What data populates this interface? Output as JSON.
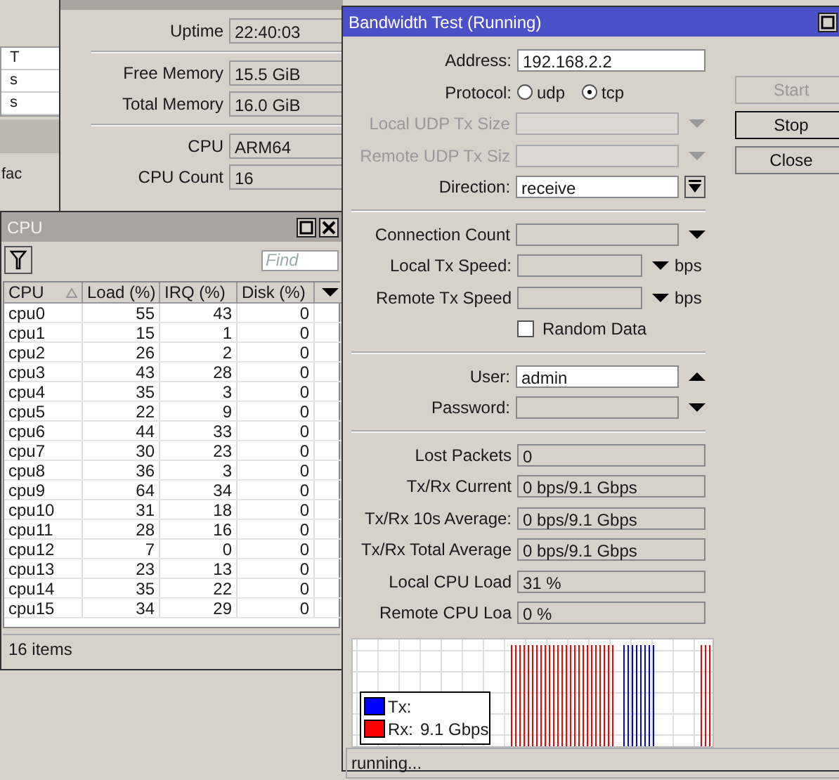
{
  "background_window": {
    "column_1": "T",
    "cells": [
      "s",
      "s"
    ],
    "label": "fac"
  },
  "resources": {
    "sections": [
      {
        "rows": [
          {
            "label": "Uptime",
            "value": "22:40:03"
          }
        ]
      },
      {
        "rows": [
          {
            "label": "Free Memory",
            "value": "15.5 GiB"
          },
          {
            "label": "Total Memory",
            "value": "16.0 GiB"
          }
        ]
      },
      {
        "rows": [
          {
            "label": "CPU",
            "value": "ARM64"
          },
          {
            "label": "CPU Count",
            "value": "16"
          }
        ]
      }
    ]
  },
  "cpu_window": {
    "title": "CPU",
    "search": {
      "placeholder": "Find"
    },
    "table": {
      "columns": [
        {
          "label": "CPU",
          "sorted": true
        },
        {
          "label": "Load (%)",
          "sorted": false
        },
        {
          "label": "IRQ (%)",
          "sorted": false
        },
        {
          "label": "Disk (%)",
          "sorted": false
        }
      ],
      "rows": [
        [
          "cpu0",
          "55",
          "43",
          "0"
        ],
        [
          "cpu1",
          "15",
          "1",
          "0"
        ],
        [
          "cpu2",
          "26",
          "2",
          "0"
        ],
        [
          "cpu3",
          "43",
          "28",
          "0"
        ],
        [
          "cpu4",
          "35",
          "3",
          "0"
        ],
        [
          "cpu5",
          "22",
          "9",
          "0"
        ],
        [
          "cpu6",
          "44",
          "33",
          "0"
        ],
        [
          "cpu7",
          "30",
          "23",
          "0"
        ],
        [
          "cpu8",
          "36",
          "3",
          "0"
        ],
        [
          "cpu9",
          "64",
          "34",
          "0"
        ],
        [
          "cpu10",
          "31",
          "18",
          "0"
        ],
        [
          "cpu11",
          "28",
          "16",
          "0"
        ],
        [
          "cpu12",
          "7",
          "0",
          "0"
        ],
        [
          "cpu13",
          "23",
          "13",
          "0"
        ],
        [
          "cpu14",
          "35",
          "22",
          "0"
        ],
        [
          "cpu15",
          "34",
          "29",
          "0"
        ]
      ]
    },
    "status_bar": "16 items"
  },
  "bandwidth_window": {
    "title": "Bandwidth Test (Running)",
    "active": true,
    "buttons": [
      {
        "label": "Start",
        "disabled": true,
        "default": false
      },
      {
        "label": "Stop",
        "disabled": false,
        "default": true
      },
      {
        "label": "Close",
        "disabled": false,
        "default": false
      }
    ],
    "sections": [
      {
        "rows": [
          {
            "kind": "text",
            "label": "Address:",
            "value": "192.168.2.2"
          },
          {
            "kind": "radio",
            "label": "Protocol:",
            "options": [
              {
                "label": "udp",
                "selected": false
              },
              {
                "label": "tcp",
                "selected": true
              }
            ]
          },
          {
            "kind": "combo",
            "label": "Local UDP Tx Size",
            "disabled": true
          },
          {
            "kind": "combo",
            "label": "Remote UDP Tx Siz",
            "disabled": true
          },
          {
            "kind": "select",
            "label": "Direction:",
            "value": "receive"
          }
        ]
      },
      {
        "rows": [
          {
            "kind": "combo",
            "label": "Connection Count",
            "disabled": false
          },
          {
            "kind": "combo",
            "label": "Local Tx Speed:",
            "disabled": false,
            "unit": "bps"
          },
          {
            "kind": "combo",
            "label": "Remote Tx Speed",
            "disabled": false,
            "unit": "bps"
          },
          {
            "kind": "checkbox",
            "label": "Random Data",
            "checked": false
          }
        ]
      },
      {
        "rows": [
          {
            "kind": "text",
            "label": "User:",
            "value": "admin",
            "removable": true
          },
          {
            "kind": "combo",
            "label": "Password:",
            "disabled": false
          }
        ]
      },
      {
        "rows": [
          {
            "kind": "readonly",
            "label": "Lost Packets",
            "value": "0"
          },
          {
            "kind": "readonly",
            "label": "Tx/Rx Current",
            "value": "0 bps/9.1 Gbps"
          },
          {
            "kind": "readonly",
            "label": "Tx/Rx 10s Average:",
            "value": "0 bps/9.1 Gbps"
          },
          {
            "kind": "readonly",
            "label": "Tx/Rx Total Average",
            "value": "0 bps/9.1 Gbps"
          },
          {
            "kind": "readonly",
            "label": "Local CPU Load",
            "value": "31 %"
          },
          {
            "kind": "readonly",
            "label": "Remote CPU Loa",
            "value": "0 %"
          }
        ]
      }
    ],
    "graph": {
      "legend": [
        {
          "label": "Tx:",
          "color": "#0000ff"
        },
        {
          "label": "Rx:",
          "value": "9.1 Gbps",
          "color": "#ff0000"
        }
      ]
    },
    "status_bar": "running..."
  }
}
